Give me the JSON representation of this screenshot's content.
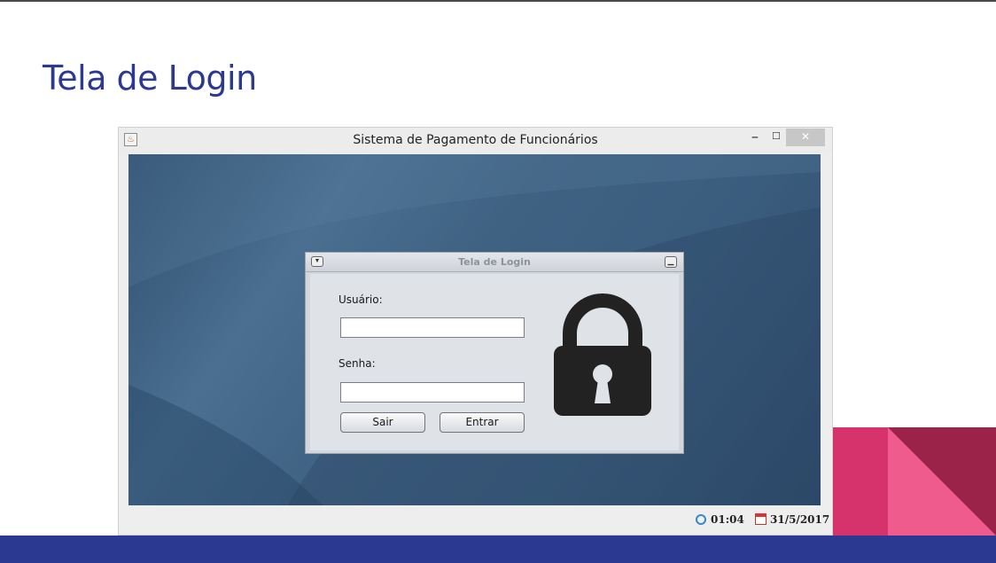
{
  "slide": {
    "title": "Tela de Login",
    "colors": {
      "title": "#2b3990",
      "bottom_bar": "#2b3990",
      "accent_pink": "#d6336c",
      "accent_dark": "#9b2248"
    }
  },
  "app": {
    "window_title": "Sistema de Pagamento de Funcionários",
    "window_buttons": [
      "minimize",
      "maximize",
      "close"
    ],
    "icon": "java-cup-icon"
  },
  "login_frame": {
    "title": "Tela de Login",
    "user_label": "Usuário:",
    "user_value": "",
    "password_label": "Senha:",
    "password_value": "",
    "exit_button": "Sair",
    "enter_button": "Entrar",
    "icon": "lock-icon"
  },
  "statusbar": {
    "time": "01:04",
    "date": "31/5/2017",
    "icons": [
      "clock-icon",
      "calendar-icon"
    ]
  }
}
